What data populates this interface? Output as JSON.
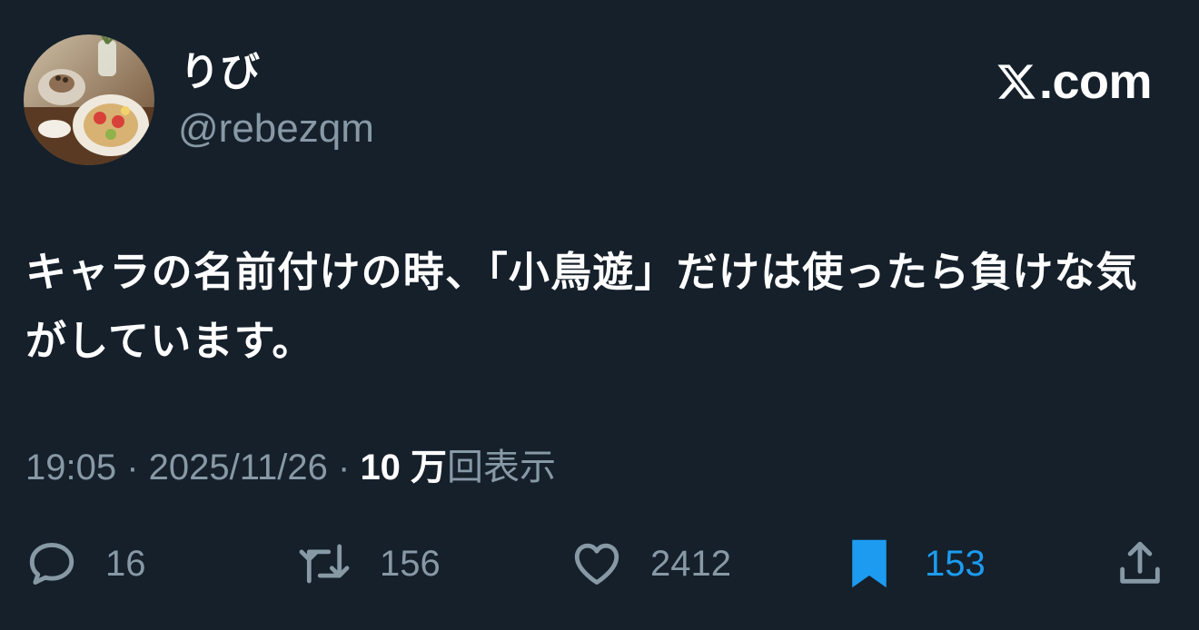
{
  "author": {
    "display_name": "りび",
    "handle": "@rebezqm"
  },
  "brand": {
    "logo_icon": "x-logo-icon",
    "text": ".com"
  },
  "tweet": {
    "text": "キャラの名前付けの時、「小鳥遊」だけは使ったら負けな気がしています。"
  },
  "meta": {
    "time": "19:05",
    "separator": " · ",
    "date": "2025/11/26",
    "views_count": "10 万",
    "views_label": "回表示"
  },
  "actions": {
    "reply": {
      "icon": "reply-icon",
      "count": "16"
    },
    "retweet": {
      "icon": "retweet-icon",
      "count": "156"
    },
    "like": {
      "icon": "heart-icon",
      "count": "2412"
    },
    "bookmark": {
      "icon": "bookmark-filled-icon",
      "count": "153",
      "active": true
    },
    "share": {
      "icon": "share-icon"
    }
  },
  "colors": {
    "background": "#15202b",
    "text_primary": "#ffffff",
    "text_secondary": "#8899a6",
    "accent": "#1d9bf0"
  }
}
